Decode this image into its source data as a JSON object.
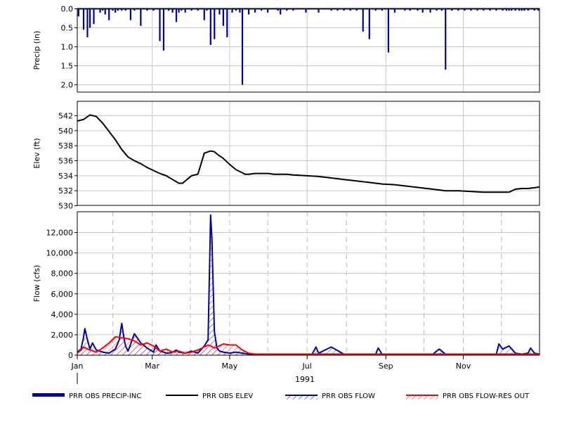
{
  "chart_data": [
    {
      "type": "bar",
      "ylabel": "Precip (in)",
      "ylim": [
        2.2,
        0.0
      ],
      "yticks": [
        "0.0",
        "0.5",
        "1.0",
        "1.5",
        "2.0"
      ],
      "inverted": true,
      "color": "#0000a0",
      "series": [
        {
          "name": "PRR OBS PRECIP-INC",
          "x": [
            1,
            5,
            8,
            10,
            13,
            18,
            20,
            22,
            25,
            28,
            30,
            32,
            35,
            38,
            42,
            45,
            50,
            55,
            60,
            65,
            68,
            72,
            75,
            78,
            80,
            82,
            85,
            90,
            95,
            100,
            102,
            105,
            108,
            112,
            115,
            118,
            122,
            125,
            128,
            130,
            135,
            140,
            145,
            150,
            158,
            160,
            165,
            170,
            180,
            190,
            200,
            205,
            210,
            215,
            220,
            225,
            230,
            235,
            240,
            245,
            250,
            258,
            262,
            268,
            272,
            278,
            283,
            287,
            290,
            295,
            300,
            305,
            310,
            315,
            320,
            325,
            330,
            335,
            338,
            340,
            342,
            345,
            348,
            350,
            352,
            355,
            360,
            363
          ],
          "values": [
            0.2,
            0.55,
            0.75,
            0.5,
            0.4,
            0.1,
            0.05,
            0.15,
            0.3,
            0.05,
            0.1,
            0.05,
            0.05,
            0.05,
            0.3,
            0.05,
            0.45,
            0.05,
            0.05,
            0.85,
            1.1,
            0.05,
            0.1,
            0.35,
            0.1,
            0.05,
            0.1,
            0.05,
            0.05,
            0.3,
            0.05,
            0.95,
            0.8,
            0.15,
            0.45,
            0.75,
            0.1,
            0.05,
            0.1,
            2.0,
            0.15,
            0.1,
            0.05,
            0.1,
            0.05,
            0.15,
            0.05,
            0.05,
            0.1,
            0.1,
            0.05,
            0.05,
            0.05,
            0.05,
            0.05,
            0.6,
            0.8,
            0.05,
            0.05,
            1.15,
            0.1,
            0.05,
            0.05,
            0.05,
            0.1,
            0.1,
            0.05,
            0.05,
            1.6,
            0.05,
            0.05,
            0.05,
            0.05,
            0.05,
            0.05,
            0.05,
            0.05,
            0.05,
            0.05,
            0.05,
            0.05,
            0.05,
            0.05,
            0.05,
            0.05,
            0.05,
            0.05,
            0.05
          ]
        }
      ]
    },
    {
      "type": "line",
      "ylabel": "Elev (ft)",
      "ylim": [
        530,
        544
      ],
      "yticks": [
        "530",
        "532",
        "534",
        "536",
        "538",
        "540",
        "542"
      ],
      "color": "#000000",
      "series": [
        {
          "name": "PRR OBS ELEV",
          "x": [
            0,
            5,
            10,
            15,
            20,
            25,
            30,
            35,
            40,
            45,
            50,
            55,
            60,
            65,
            70,
            72,
            75,
            78,
            80,
            83,
            85,
            90,
            95,
            100,
            105,
            108,
            110,
            115,
            120,
            125,
            130,
            132,
            135,
            140,
            145,
            150,
            155,
            160,
            165,
            170,
            180,
            190,
            200,
            210,
            220,
            230,
            240,
            250,
            260,
            270,
            280,
            290,
            300,
            310,
            320,
            330,
            335,
            340,
            345,
            350,
            355,
            360,
            364
          ],
          "values": [
            541.3,
            541.5,
            542.1,
            541.9,
            541.0,
            539.9,
            538.8,
            537.5,
            536.5,
            536.0,
            535.6,
            535.1,
            534.7,
            534.3,
            534.0,
            533.8,
            533.5,
            533.2,
            533.0,
            533.0,
            533.3,
            534.0,
            534.2,
            537.0,
            537.3,
            537.2,
            536.9,
            536.3,
            535.5,
            534.8,
            534.4,
            534.2,
            534.2,
            534.3,
            534.3,
            534.3,
            534.2,
            534.2,
            534.2,
            534.1,
            534.0,
            533.9,
            533.7,
            533.5,
            533.3,
            533.1,
            532.9,
            532.8,
            532.6,
            532.4,
            532.2,
            532.0,
            532.0,
            531.9,
            531.8,
            531.8,
            531.8,
            531.8,
            532.2,
            532.3,
            532.3,
            532.4,
            532.5
          ]
        }
      ]
    },
    {
      "type": "line",
      "ylabel": "Flow (cfs)",
      "ylim": [
        0,
        14000
      ],
      "yticks": [
        "0",
        "2,000",
        "4,000",
        "6,000",
        "8,000",
        "10,000",
        "12,000"
      ],
      "series": [
        {
          "name": "PRR OBS FLOW",
          "color": "#0000a0",
          "x": [
            0,
            3,
            5,
            6,
            8,
            10,
            12,
            15,
            20,
            25,
            30,
            33,
            35,
            37,
            38,
            40,
            45,
            50,
            55,
            60,
            62,
            65,
            68,
            70,
            72,
            75,
            78,
            80,
            85,
            90,
            95,
            100,
            103,
            105,
            106,
            108,
            110,
            112,
            115,
            120,
            125,
            130,
            135,
            140,
            150,
            160,
            170,
            180,
            185,
            188,
            190,
            200,
            210,
            220,
            230,
            235,
            237,
            240,
            250,
            260,
            270,
            280,
            285,
            290,
            300,
            310,
            320,
            330,
            332,
            335,
            340,
            345,
            350,
            355,
            357,
            360,
            364
          ],
          "values": [
            300,
            600,
            1800,
            2600,
            1500,
            600,
            1200,
            500,
            300,
            200,
            600,
            1500,
            3100,
            1500,
            900,
            400,
            2100,
            1200,
            700,
            300,
            1000,
            400,
            300,
            200,
            200,
            300,
            500,
            300,
            200,
            400,
            200,
            900,
            1500,
            13700,
            11500,
            2300,
            700,
            400,
            300,
            200,
            300,
            200,
            100,
            100,
            100,
            100,
            100,
            100,
            100,
            800,
            200,
            800,
            100,
            100,
            100,
            100,
            700,
            100,
            100,
            100,
            100,
            100,
            600,
            100,
            100,
            100,
            100,
            100,
            1100,
            600,
            900,
            200,
            100,
            200,
            700,
            200,
            100
          ]
        },
        {
          "name": "PRR OBS FLOW-RES OUT",
          "color": "#ff0000",
          "x": [
            0,
            3,
            5,
            8,
            10,
            15,
            20,
            25,
            30,
            35,
            40,
            45,
            50,
            55,
            60,
            65,
            70,
            75,
            80,
            85,
            90,
            95,
            100,
            103,
            105,
            108,
            110,
            115,
            120,
            125,
            130,
            135,
            140,
            150,
            160,
            170,
            180,
            190,
            200,
            210,
            220,
            230,
            240,
            250,
            260,
            270,
            280,
            290,
            300,
            310,
            320,
            330,
            340,
            350,
            360,
            364
          ],
          "values": [
            200,
            500,
            800,
            600,
            500,
            300,
            700,
            1200,
            1800,
            1700,
            1600,
            1400,
            1000,
            1200,
            900,
            400,
            600,
            300,
            400,
            200,
            300,
            500,
            800,
            1000,
            900,
            700,
            800,
            1100,
            1000,
            1000,
            500,
            200,
            100,
            100,
            100,
            100,
            100,
            100,
            100,
            100,
            100,
            100,
            100,
            100,
            100,
            100,
            100,
            100,
            100,
            100,
            100,
            100,
            100,
            100,
            100,
            100
          ]
        }
      ]
    }
  ],
  "x_axis": {
    "ticks": [
      {
        "label": "Jan",
        "day": 0
      },
      {
        "label": "Mar",
        "day": 59
      },
      {
        "label": "May",
        "day": 120
      },
      {
        "label": "Jul",
        "day": 181
      },
      {
        "label": "Sep",
        "day": 243
      },
      {
        "label": "Nov",
        "day": 304
      }
    ],
    "year_label": "1991"
  },
  "legend": [
    {
      "name": "PRR OBS PRECIP-INC",
      "color": "#0000a0",
      "style": "thick"
    },
    {
      "name": "PRR OBS ELEV",
      "color": "#000000",
      "style": "line"
    },
    {
      "name": "PRR OBS FLOW",
      "color": "#0000a0",
      "style": "hatch"
    },
    {
      "name": "PRR OBS FLOW-RES OUT",
      "color": "#ff0000",
      "style": "hatch"
    }
  ]
}
